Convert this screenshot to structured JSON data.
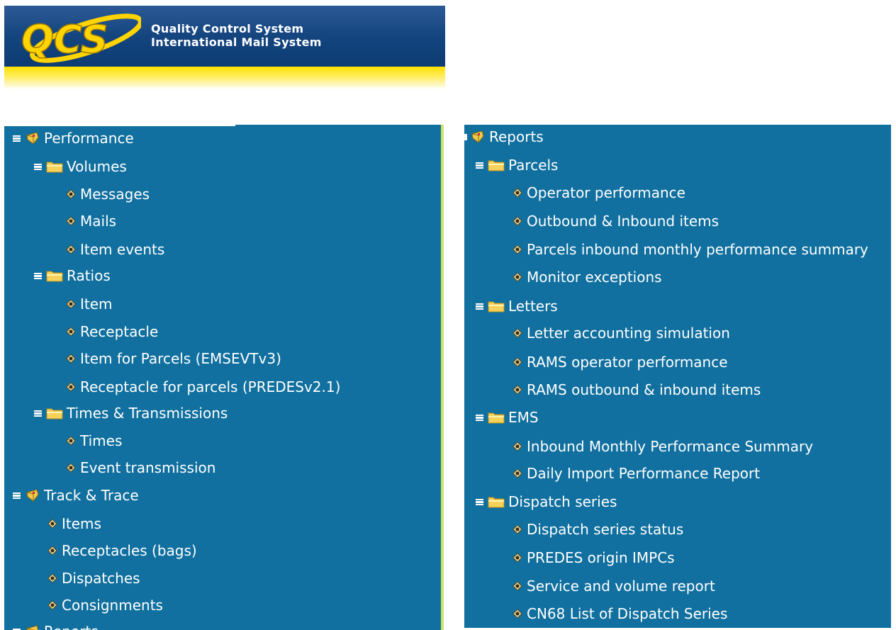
{
  "banner": {
    "logo_text": "QCS",
    "line1": "Quality Control System",
    "line2": "International Mail System"
  },
  "colors": {
    "panel_bg": "#11709f",
    "banner_blue": "#14457f",
    "banner_yellow": "#ffe000",
    "text": "#ffffff"
  },
  "left_tree": {
    "performance": "Performance",
    "volumes": "Volumes",
    "messages": "Messages",
    "mails": "Mails",
    "item_events": "Item events",
    "ratios": "Ratios",
    "item": "Item",
    "receptacle": "Receptacle",
    "item_parcels": "Item for Parcels (EMSEVTv3)",
    "receptacle_parcels": "Receptacle for parcels (PREDESv2.1)",
    "times_transmissions": "Times & Transmissions",
    "times": "Times",
    "event_transmission": "Event transmission",
    "track_trace": "Track & Trace",
    "items": "Items",
    "receptacles_bags": "Receptacles (bags)",
    "dispatches": "Dispatches",
    "consignments": "Consignments",
    "reports_partial": "Reports"
  },
  "right_tree": {
    "reports": "Reports",
    "parcels": "Parcels",
    "operator_performance": "Operator performance",
    "outbound_inbound": "Outbound & Inbound items",
    "parcels_summary": "Parcels inbound monthly performance summary",
    "monitor_exceptions": "Monitor exceptions",
    "letters": "Letters",
    "letter_accounting": "Letter accounting simulation",
    "rams_operator": "RAMS operator performance",
    "rams_items": "RAMS outbound & inbound items",
    "ems": "EMS",
    "inbound_summary": "Inbound Monthly Performance Summary",
    "daily_import": "Daily Import Performance Report",
    "dispatch_series": "Dispatch series",
    "dispatch_status": "Dispatch series status",
    "predes_origin": "PREDES origin IMPCs",
    "service_volume": "Service and volume report",
    "cn68": "CN68 List of Dispatch Series"
  }
}
